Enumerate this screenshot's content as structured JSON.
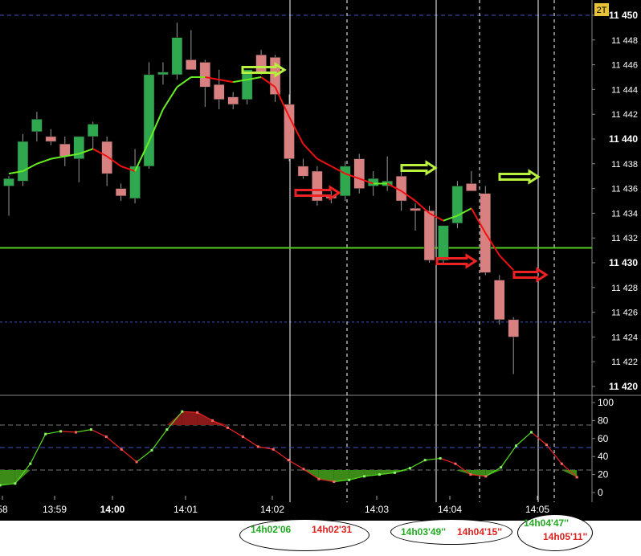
{
  "colors": {
    "background": "#000000",
    "bull": "#2fa84f",
    "bear": "#d98080",
    "sma_up": "#66ee22",
    "sma_down": "#ee1111",
    "hline": "#55cc22",
    "price_text": "#ffffff",
    "arrow_green": "#b8f040",
    "arrow_red": "#ee2222",
    "annotation_green": "#22aa22",
    "annotation_red": "#dd2222"
  },
  "badge": "2T",
  "chart_data": [
    {
      "type": "candlestick",
      "title": "",
      "ylim": [
        11419,
        11451
      ],
      "yticks": [
        {
          "value": 11450,
          "label": "11 450",
          "bold": true
        },
        {
          "value": 11448,
          "label": "11 448",
          "bold": false
        },
        {
          "value": 11446,
          "label": "11 446",
          "bold": false
        },
        {
          "value": 11444,
          "label": "11 444",
          "bold": false
        },
        {
          "value": 11442,
          "label": "11 442",
          "bold": false
        },
        {
          "value": 11440,
          "label": "11 440",
          "bold": true
        },
        {
          "value": 11438,
          "label": "11 438",
          "bold": false
        },
        {
          "value": 11436,
          "label": "11 436",
          "bold": false
        },
        {
          "value": 11434,
          "label": "11 434",
          "bold": false
        },
        {
          "value": 11432,
          "label": "11 432",
          "bold": false
        },
        {
          "value": 11430,
          "label": "11 430",
          "bold": true
        },
        {
          "value": 11428,
          "label": "11 428",
          "bold": false
        },
        {
          "value": 11426,
          "label": "11 426",
          "bold": false
        },
        {
          "value": 11424,
          "label": "11 424",
          "bold": false
        },
        {
          "value": 11422,
          "label": "11 422",
          "bold": false
        },
        {
          "value": 11420,
          "label": "11 420",
          "bold": true
        }
      ],
      "candles": [
        {
          "o": 11436.2,
          "h": 11437,
          "l": 11433.8,
          "c": 11436.8
        },
        {
          "o": 11436.6,
          "h": 11440.4,
          "l": 11436.2,
          "c": 11439.8
        },
        {
          "o": 11440.6,
          "h": 11442.2,
          "l": 11439.8,
          "c": 11441.6
        },
        {
          "o": 11440.2,
          "h": 11440.8,
          "l": 11439.5,
          "c": 11439.8
        },
        {
          "o": 11439.6,
          "h": 11440.2,
          "l": 11437.8,
          "c": 11438.6
        },
        {
          "o": 11438.4,
          "h": 11439.8,
          "l": 11436.5,
          "c": 11440.2
        },
        {
          "o": 11440.2,
          "h": 11441.4,
          "l": 11439.2,
          "c": 11441.2
        },
        {
          "o": 11439.8,
          "h": 11440.2,
          "l": 11436.2,
          "c": 11437.2
        },
        {
          "o": 11436,
          "h": 11436.4,
          "l": 11435,
          "c": 11435.4
        },
        {
          "o": 11435.2,
          "h": 11439.2,
          "l": 11434.8,
          "c": 11437.8
        },
        {
          "o": 11437.8,
          "h": 11446.2,
          "l": 11437.6,
          "c": 11445.2
        },
        {
          "o": 11445.2,
          "h": 11446.2,
          "l": 11444.4,
          "c": 11445.4
        },
        {
          "o": 11445.2,
          "h": 11449.4,
          "l": 11444.8,
          "c": 11448.2
        },
        {
          "o": 11446.4,
          "h": 11448.8,
          "l": 11446.2,
          "c": 11445.6
        },
        {
          "o": 11446.2,
          "h": 11446.4,
          "l": 11442.6,
          "c": 11444.2
        },
        {
          "o": 11444.4,
          "h": 11445.6,
          "l": 11442.4,
          "c": 11443.2
        },
        {
          "o": 11443.4,
          "h": 11443.8,
          "l": 11442.4,
          "c": 11442.8
        },
        {
          "o": 11443.2,
          "h": 11445.2,
          "l": 11442.8,
          "c": 11445.6
        },
        {
          "o": 11446.8,
          "h": 11447.2,
          "l": 11445.2,
          "c": 11445.4
        },
        {
          "o": 11446.6,
          "h": 11446.8,
          "l": 11443,
          "c": 11443.6
        },
        {
          "o": 11442.8,
          "h": 11443.6,
          "l": 11438.2,
          "c": 11438.4
        },
        {
          "o": 11437.8,
          "h": 11438.4,
          "l": 11436.8,
          "c": 11437
        },
        {
          "o": 11437.4,
          "h": 11437.8,
          "l": 11434.6,
          "c": 11435
        },
        {
          "o": 11435.4,
          "h": 11435.8,
          "l": 11434.8,
          "c": 11435.2
        },
        {
          "o": 11435.4,
          "h": 11438.2,
          "l": 11435,
          "c": 11437.8
        },
        {
          "o": 11438.4,
          "h": 11438.8,
          "l": 11435.6,
          "c": 11436
        },
        {
          "o": 11436.2,
          "h": 11437.4,
          "l": 11435.4,
          "c": 11436.8
        },
        {
          "o": 11436.2,
          "h": 11438.6,
          "l": 11435.8,
          "c": 11436.6
        },
        {
          "o": 11437,
          "h": 11437.6,
          "l": 11434.2,
          "c": 11435
        },
        {
          "o": 11434.4,
          "h": 11434.8,
          "l": 11432.6,
          "c": 11434.2
        },
        {
          "o": 11434.2,
          "h": 11434.6,
          "l": 11430,
          "c": 11430.2
        },
        {
          "o": 11430.2,
          "h": 11433,
          "l": 11430,
          "c": 11433
        },
        {
          "o": 11433.2,
          "h": 11436.6,
          "l": 11432.8,
          "c": 11436.2
        },
        {
          "o": 11436.4,
          "h": 11437.4,
          "l": 11435.8,
          "c": 11435.8
        },
        {
          "o": 11435.6,
          "h": 11436.2,
          "l": 11429,
          "c": 11429.2
        },
        {
          "o": 11428.6,
          "h": 11429,
          "l": 11425,
          "c": 11425.4
        },
        {
          "o": 11425.4,
          "h": 11425.6,
          "l": 11421,
          "c": 11424
        }
      ],
      "sma": [
        11437.2,
        11437.4,
        11438,
        11438.4,
        11438.6,
        11438.8,
        11439.2,
        11438.6,
        11437.8,
        11437.4,
        11439.8,
        11442.4,
        11444.2,
        11445,
        11445,
        11444.8,
        11444.6,
        11444.8,
        11445,
        11444.2,
        11441.8,
        11439.6,
        11438.4,
        11437.8,
        11437.2,
        11436.8,
        11436.4,
        11436.4,
        11435.8,
        11435,
        11434,
        11433.4,
        11433.8,
        11434.4,
        11432.4,
        11430.6,
        11429.4
      ],
      "hline": 11431.2,
      "dashed_level": 11425.2
    },
    {
      "type": "line",
      "title": "",
      "ylim": [
        -2,
        103
      ],
      "yticks": [
        100,
        80,
        60,
        40,
        20,
        0
      ],
      "dashed_levels": [
        75,
        50,
        25
      ],
      "values": [
        8,
        10,
        32,
        65,
        68,
        67,
        70,
        62,
        48,
        34,
        47,
        70,
        90,
        89,
        80,
        72,
        62,
        51,
        48,
        36,
        26,
        15,
        12,
        14,
        18,
        20,
        22,
        27,
        36,
        38,
        32,
        20,
        18,
        28,
        52,
        67,
        53,
        32,
        17
      ],
      "xticks": [
        {
          "label": "58",
          "bold": false
        },
        {
          "label": "13:59",
          "bold": false
        },
        {
          "label": "14:00",
          "bold": true
        },
        {
          "label": "14:01",
          "bold": false
        },
        {
          "label": "14:02",
          "bold": false
        },
        {
          "label": "14:03",
          "bold": false
        },
        {
          "label": "14:04",
          "bold": false
        },
        {
          "label": "14:05",
          "bold": false
        }
      ]
    }
  ],
  "annotations": {
    "group1": {
      "green": "14h02'06",
      "red": "14h02'31"
    },
    "group2": {
      "green": "14h03'49''",
      "red": "14h04'15''"
    },
    "group3": {
      "green": "14h04'47''",
      "red": "14h05'11''"
    }
  }
}
